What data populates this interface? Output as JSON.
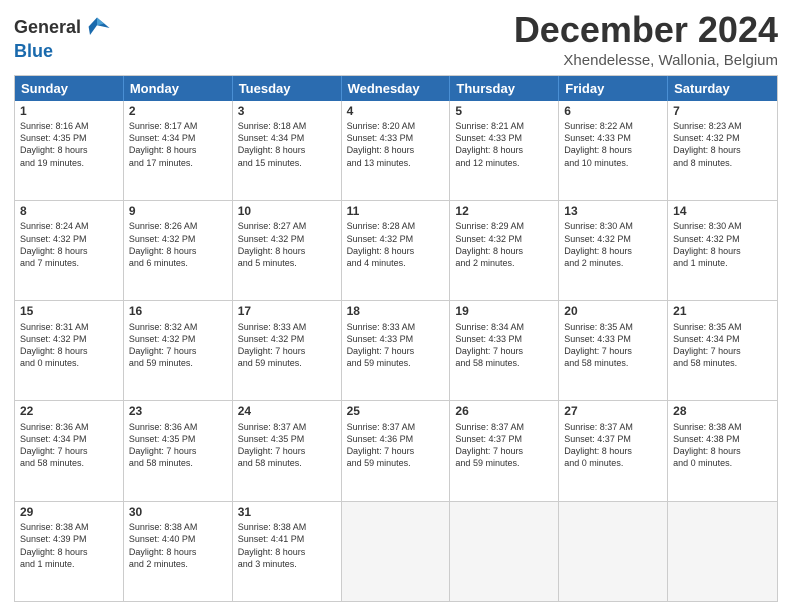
{
  "logo": {
    "line1": "General",
    "line2": "Blue"
  },
  "title": "December 2024",
  "location": "Xhendelesse, Wallonia, Belgium",
  "days_header": [
    "Sunday",
    "Monday",
    "Tuesday",
    "Wednesday",
    "Thursday",
    "Friday",
    "Saturday"
  ],
  "weeks": [
    [
      {
        "day": "1",
        "lines": [
          "Sunrise: 8:16 AM",
          "Sunset: 4:35 PM",
          "Daylight: 8 hours",
          "and 19 minutes."
        ]
      },
      {
        "day": "2",
        "lines": [
          "Sunrise: 8:17 AM",
          "Sunset: 4:34 PM",
          "Daylight: 8 hours",
          "and 17 minutes."
        ]
      },
      {
        "day": "3",
        "lines": [
          "Sunrise: 8:18 AM",
          "Sunset: 4:34 PM",
          "Daylight: 8 hours",
          "and 15 minutes."
        ]
      },
      {
        "day": "4",
        "lines": [
          "Sunrise: 8:20 AM",
          "Sunset: 4:33 PM",
          "Daylight: 8 hours",
          "and 13 minutes."
        ]
      },
      {
        "day": "5",
        "lines": [
          "Sunrise: 8:21 AM",
          "Sunset: 4:33 PM",
          "Daylight: 8 hours",
          "and 12 minutes."
        ]
      },
      {
        "day": "6",
        "lines": [
          "Sunrise: 8:22 AM",
          "Sunset: 4:33 PM",
          "Daylight: 8 hours",
          "and 10 minutes."
        ]
      },
      {
        "day": "7",
        "lines": [
          "Sunrise: 8:23 AM",
          "Sunset: 4:32 PM",
          "Daylight: 8 hours",
          "and 8 minutes."
        ]
      }
    ],
    [
      {
        "day": "8",
        "lines": [
          "Sunrise: 8:24 AM",
          "Sunset: 4:32 PM",
          "Daylight: 8 hours",
          "and 7 minutes."
        ]
      },
      {
        "day": "9",
        "lines": [
          "Sunrise: 8:26 AM",
          "Sunset: 4:32 PM",
          "Daylight: 8 hours",
          "and 6 minutes."
        ]
      },
      {
        "day": "10",
        "lines": [
          "Sunrise: 8:27 AM",
          "Sunset: 4:32 PM",
          "Daylight: 8 hours",
          "and 5 minutes."
        ]
      },
      {
        "day": "11",
        "lines": [
          "Sunrise: 8:28 AM",
          "Sunset: 4:32 PM",
          "Daylight: 8 hours",
          "and 4 minutes."
        ]
      },
      {
        "day": "12",
        "lines": [
          "Sunrise: 8:29 AM",
          "Sunset: 4:32 PM",
          "Daylight: 8 hours",
          "and 2 minutes."
        ]
      },
      {
        "day": "13",
        "lines": [
          "Sunrise: 8:30 AM",
          "Sunset: 4:32 PM",
          "Daylight: 8 hours",
          "and 2 minutes."
        ]
      },
      {
        "day": "14",
        "lines": [
          "Sunrise: 8:30 AM",
          "Sunset: 4:32 PM",
          "Daylight: 8 hours",
          "and 1 minute."
        ]
      }
    ],
    [
      {
        "day": "15",
        "lines": [
          "Sunrise: 8:31 AM",
          "Sunset: 4:32 PM",
          "Daylight: 8 hours",
          "and 0 minutes."
        ]
      },
      {
        "day": "16",
        "lines": [
          "Sunrise: 8:32 AM",
          "Sunset: 4:32 PM",
          "Daylight: 7 hours",
          "and 59 minutes."
        ]
      },
      {
        "day": "17",
        "lines": [
          "Sunrise: 8:33 AM",
          "Sunset: 4:32 PM",
          "Daylight: 7 hours",
          "and 59 minutes."
        ]
      },
      {
        "day": "18",
        "lines": [
          "Sunrise: 8:33 AM",
          "Sunset: 4:33 PM",
          "Daylight: 7 hours",
          "and 59 minutes."
        ]
      },
      {
        "day": "19",
        "lines": [
          "Sunrise: 8:34 AM",
          "Sunset: 4:33 PM",
          "Daylight: 7 hours",
          "and 58 minutes."
        ]
      },
      {
        "day": "20",
        "lines": [
          "Sunrise: 8:35 AM",
          "Sunset: 4:33 PM",
          "Daylight: 7 hours",
          "and 58 minutes."
        ]
      },
      {
        "day": "21",
        "lines": [
          "Sunrise: 8:35 AM",
          "Sunset: 4:34 PM",
          "Daylight: 7 hours",
          "and 58 minutes."
        ]
      }
    ],
    [
      {
        "day": "22",
        "lines": [
          "Sunrise: 8:36 AM",
          "Sunset: 4:34 PM",
          "Daylight: 7 hours",
          "and 58 minutes."
        ]
      },
      {
        "day": "23",
        "lines": [
          "Sunrise: 8:36 AM",
          "Sunset: 4:35 PM",
          "Daylight: 7 hours",
          "and 58 minutes."
        ]
      },
      {
        "day": "24",
        "lines": [
          "Sunrise: 8:37 AM",
          "Sunset: 4:35 PM",
          "Daylight: 7 hours",
          "and 58 minutes."
        ]
      },
      {
        "day": "25",
        "lines": [
          "Sunrise: 8:37 AM",
          "Sunset: 4:36 PM",
          "Daylight: 7 hours",
          "and 59 minutes."
        ]
      },
      {
        "day": "26",
        "lines": [
          "Sunrise: 8:37 AM",
          "Sunset: 4:37 PM",
          "Daylight: 7 hours",
          "and 59 minutes."
        ]
      },
      {
        "day": "27",
        "lines": [
          "Sunrise: 8:37 AM",
          "Sunset: 4:37 PM",
          "Daylight: 8 hours",
          "and 0 minutes."
        ]
      },
      {
        "day": "28",
        "lines": [
          "Sunrise: 8:38 AM",
          "Sunset: 4:38 PM",
          "Daylight: 8 hours",
          "and 0 minutes."
        ]
      }
    ],
    [
      {
        "day": "29",
        "lines": [
          "Sunrise: 8:38 AM",
          "Sunset: 4:39 PM",
          "Daylight: 8 hours",
          "and 1 minute."
        ]
      },
      {
        "day": "30",
        "lines": [
          "Sunrise: 8:38 AM",
          "Sunset: 4:40 PM",
          "Daylight: 8 hours",
          "and 2 minutes."
        ]
      },
      {
        "day": "31",
        "lines": [
          "Sunrise: 8:38 AM",
          "Sunset: 4:41 PM",
          "Daylight: 8 hours",
          "and 3 minutes."
        ]
      },
      {
        "day": "",
        "lines": []
      },
      {
        "day": "",
        "lines": []
      },
      {
        "day": "",
        "lines": []
      },
      {
        "day": "",
        "lines": []
      }
    ]
  ]
}
